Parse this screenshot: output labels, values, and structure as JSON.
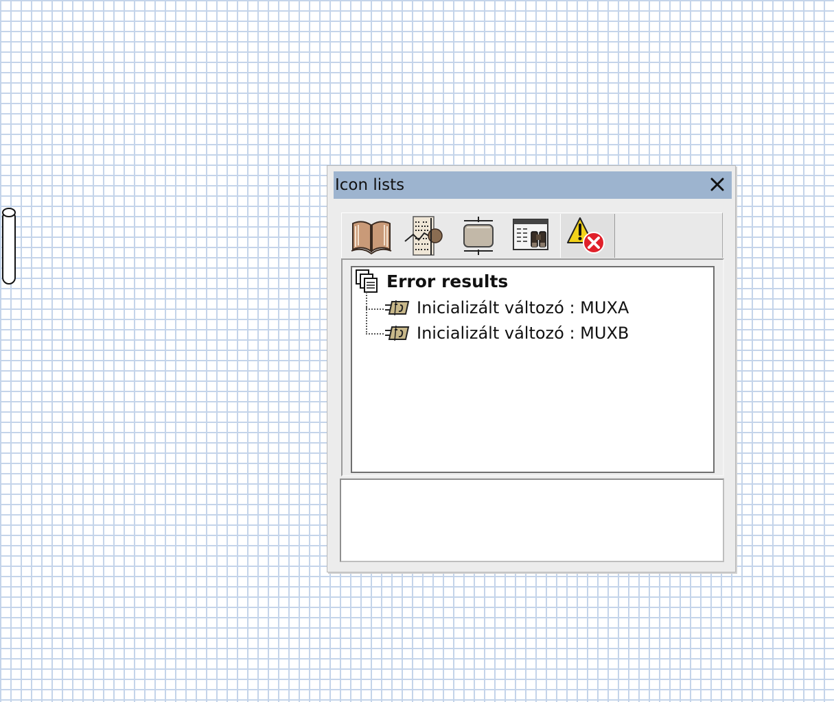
{
  "window": {
    "title": "Icon lists"
  },
  "toolbar": {
    "tools": [
      {
        "icon": "book-icon"
      },
      {
        "icon": "schematic-diagram-icon"
      },
      {
        "icon": "component-icon"
      },
      {
        "icon": "search-browser-icon"
      },
      {
        "icon": "warning-error-icon",
        "active": true
      }
    ]
  },
  "tree": {
    "root_label": "Error results",
    "items": [
      {
        "label": "Inicializált változó : MUXA",
        "icon": "variable-tag-icon"
      },
      {
        "label": "Inicializált változó : MUXB",
        "icon": "variable-tag-icon"
      }
    ]
  },
  "colors": {
    "grid_line": "#c4d4ea",
    "titlebar": "#9db4cf",
    "panel": "#ececec",
    "error_red": "#e0202a",
    "warning_yellow": "#f2d21a"
  }
}
